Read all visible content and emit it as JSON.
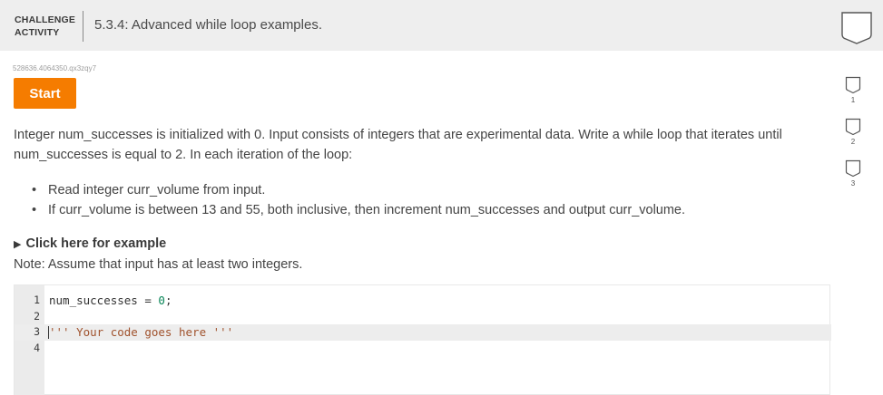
{
  "header": {
    "tag_line1": "CHALLENGE",
    "tag_line2": "ACTIVITY",
    "title": "5.3.4: Advanced while loop examples."
  },
  "challenge_id": "528636.4064350.qx3zqy7",
  "start_label": "Start",
  "prompt": "Integer num_successes is initialized with 0. Input consists of integers that are experimental data. Write a while loop that iterates until num_successes is equal to 2. In each iteration of the loop:",
  "bullets": [
    "Read integer curr_volume from input.",
    "If curr_volume is between 13 and 55, both inclusive, then increment num_successes and output curr_volume."
  ],
  "example_label": "Click here for example",
  "note": "Note: Assume that input has at least two integers.",
  "editor": {
    "line_numbers": [
      "1",
      "2",
      "3",
      "4"
    ],
    "line1_var": "num_successes",
    "line1_op": " = ",
    "line1_num": "0",
    "line1_semi": ";",
    "line3": "''' Your code goes here '''"
  },
  "levels": [
    "1",
    "2",
    "3"
  ],
  "colors": {
    "accent": "#f57c00",
    "header_bg": "#eeeeee",
    "gutter_bg": "#ebebeb"
  },
  "icons": {
    "header": "shield-outline-icon",
    "levels": "shield-outline-icon"
  }
}
